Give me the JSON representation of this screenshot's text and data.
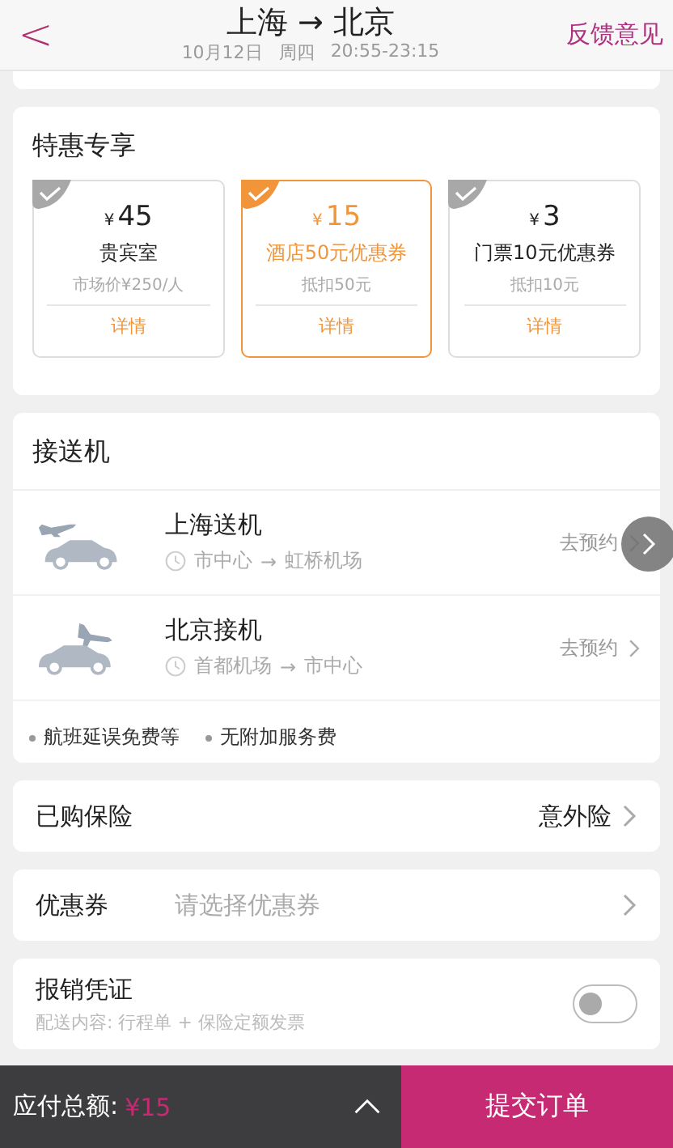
{
  "header": {
    "back": "<",
    "title_from": "上海",
    "title_arrow": "→",
    "title_to": "北京",
    "date": "10月12日",
    "weekday": "周四",
    "time": "20:55-23:15",
    "feedback": "反馈意见"
  },
  "offers": {
    "title": "特惠专享",
    "items": [
      {
        "currency": "¥",
        "price": "45",
        "name": "贵宾室",
        "note": "市场价¥250/人",
        "link": "详情",
        "selected": false
      },
      {
        "currency": "¥",
        "price": "15",
        "name": "酒店50元优惠券",
        "note": "抵扣50元",
        "link": "详情",
        "selected": true
      },
      {
        "currency": "¥",
        "price": "3",
        "name": "门票10元优惠券",
        "note": "抵扣10元",
        "link": "详情",
        "selected": false
      }
    ]
  },
  "transfer": {
    "title": "接送机",
    "rows": [
      {
        "kind": "dropoff",
        "name": "上海送机",
        "from": "市中心",
        "arrow": "→",
        "to": "虹桥机场",
        "action": "去预约"
      },
      {
        "kind": "pickup",
        "name": "北京接机",
        "from": "首都机场",
        "arrow": "→",
        "to": "市中心",
        "action": "去预约"
      }
    ],
    "perks": [
      "航班延误免费等",
      "无附加服务费"
    ]
  },
  "insurance": {
    "label": "已购保险",
    "value": "意外险"
  },
  "coupon": {
    "label": "优惠券",
    "placeholder": "请选择优惠券"
  },
  "invoice": {
    "label": "报销凭证",
    "note": "配送内容: 行程单 + 保险定额发票",
    "on": false
  },
  "footer": {
    "total_label": "应付总额:",
    "total": "¥15",
    "submit": "提交订单"
  }
}
